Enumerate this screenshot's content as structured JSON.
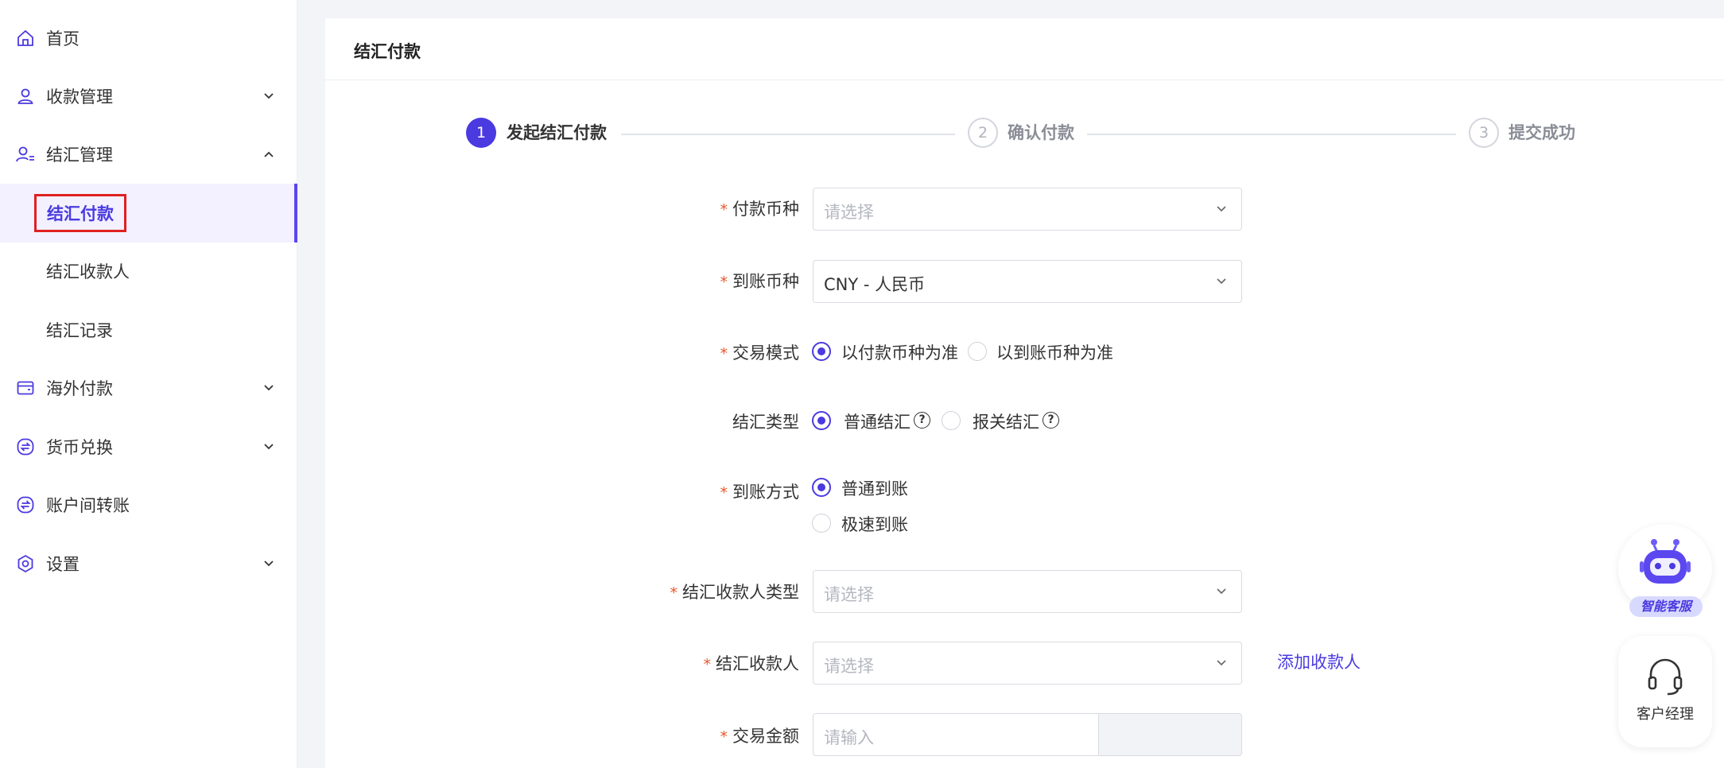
{
  "sidebar": {
    "items": [
      {
        "label": "首页",
        "icon": "home-icon"
      },
      {
        "label": "收款管理",
        "icon": "user-icon"
      },
      {
        "label": "结汇管理",
        "icon": "user-list-icon"
      },
      {
        "label": "海外付款",
        "icon": "wallet-icon"
      },
      {
        "label": "货币兑换",
        "icon": "exchange-icon"
      },
      {
        "label": "账户间转账",
        "icon": "transfer-icon"
      },
      {
        "label": "设置",
        "icon": "settings-icon"
      }
    ],
    "sub_items": [
      {
        "label": "结汇付款",
        "active": true
      },
      {
        "label": "结汇收款人"
      },
      {
        "label": "结汇记录"
      }
    ]
  },
  "page": {
    "title": "结汇付款"
  },
  "steps": [
    {
      "num": "1",
      "label": "发起结汇付款",
      "active": true
    },
    {
      "num": "2",
      "label": "确认付款",
      "active": false
    },
    {
      "num": "3",
      "label": "提交成功",
      "active": false
    }
  ],
  "form": {
    "pay_currency": {
      "label": "付款币种",
      "placeholder": "请选择"
    },
    "receive_currency": {
      "label": "到账币种",
      "value": "CNY - 人民币"
    },
    "trade_mode": {
      "label": "交易模式",
      "option1": "以付款币种为准",
      "option2": "以到账币种为准"
    },
    "settle_type": {
      "label": "结汇类型",
      "option1": "普通结汇",
      "option2": "报关结汇",
      "help": "?"
    },
    "arrival_method": {
      "label": "到账方式",
      "option1": "普通到账",
      "option2": "极速到账"
    },
    "payee_type": {
      "label": "结汇收款人类型",
      "placeholder": "请选择"
    },
    "payee": {
      "label": "结汇收款人",
      "placeholder": "请选择",
      "add_link": "添加收款人"
    },
    "amount": {
      "label": "交易金额",
      "placeholder": "请输入"
    },
    "required_mark": "*"
  },
  "widgets": {
    "ai_service": "智能客服",
    "account_manager": "客户经理"
  },
  "colors": {
    "accent": "#4a3ae0",
    "required": "#e8562a",
    "highlight_border": "#e02020"
  }
}
